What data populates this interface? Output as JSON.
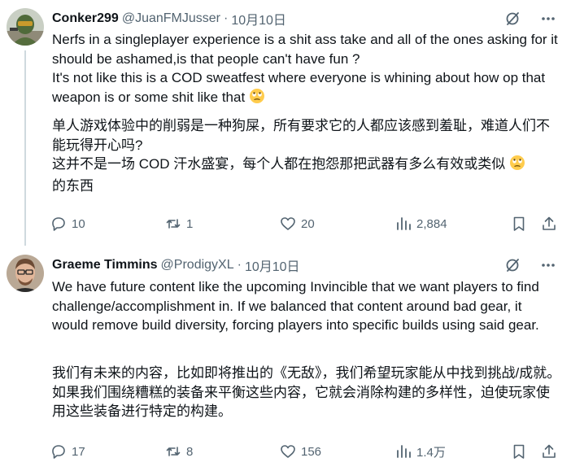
{
  "tweets": [
    {
      "name": "Conker299",
      "handle": "@JuanFMJusser",
      "separator": "·",
      "date": "10月10日",
      "text_en": "Nerfs in a singleplayer experience is a shit ass take and all of the ones asking for it should be ashamed,is that people can't have fun ?\nIt's not like this is a COD sweatfest where everyone is whining about how op that weapon is or some shit like that",
      "text_zh_1": "单人游戏体验中的削弱是一种狗屎，所有要求它的人都应该感到羞耻，难道人们不能玩得开心吗?\n这并不是一场 COD 汗水盛宴，每个人都在抱怨那把武器有多么有效或类似",
      "text_zh_2": "的东西",
      "stats": {
        "replies": "10",
        "reposts": "1",
        "likes": "20",
        "views": "2,884"
      }
    },
    {
      "name": "Graeme Timmins",
      "handle": "@ProdigyXL",
      "separator": "·",
      "date": "10月10日",
      "text_en": "We have future content like the upcoming Invincible that we want players to find challenge/accomplishment in. If we balanced that content around bad gear, it would remove build diversity, forcing players into specific builds using said gear.",
      "text_zh": "我们有未来的内容，比如即将推出的《无敌》，我们希望玩家能从中找到挑战/成就。如果我们围绕糟糕的装备来平衡这些内容，它就会消除构建的多样性，迫使玩家使用这些装备进行特定的构建。",
      "stats": {
        "replies": "17",
        "reposts": "8",
        "likes": "156",
        "views": "1.4万"
      }
    }
  ],
  "icons": {
    "slash": "grok-slash-icon",
    "more": "more-icon",
    "reply": "reply-icon",
    "repost": "repost-icon",
    "like": "like-icon",
    "views": "views-icon",
    "bookmark": "bookmark-icon",
    "share": "share-icon",
    "emoji": "rolling-eyes-emoji"
  },
  "colors": {
    "text": "#0f1419",
    "secondary": "#536471",
    "divider": "#eff3f4",
    "thread": "#cfd9de"
  }
}
